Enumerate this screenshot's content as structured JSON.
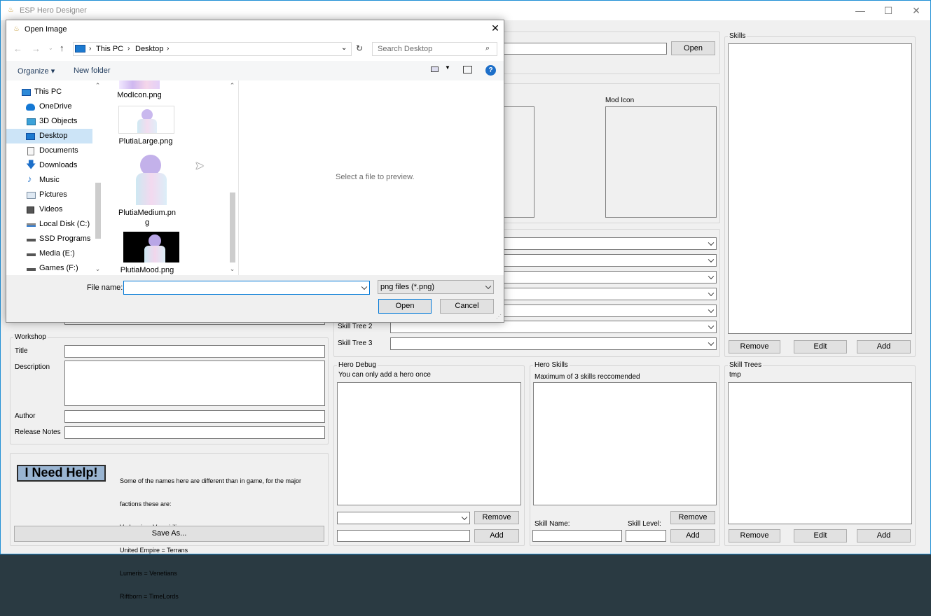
{
  "app": {
    "title": "ESP Hero Designer",
    "minimize": "—",
    "maximize": "☐",
    "close": "✕"
  },
  "top_group": {
    "open_button": "Open"
  },
  "mod_icon": {
    "label": "Mod Icon"
  },
  "skills": {
    "label": "Skills",
    "remove": "Remove",
    "edit": "Edit",
    "add": "Add"
  },
  "skill_trees_panel": {
    "label": "Skill Trees",
    "item": "tmp",
    "remove": "Remove",
    "edit": "Edit",
    "add": "Add"
  },
  "skill_tree_fields": {
    "tree2": "Skill Tree 2",
    "tree3": "Skill Tree 3"
  },
  "workshop": {
    "label": "Workshop",
    "title": "Title",
    "description": "Description",
    "author": "Author",
    "release_notes": "Release Notes"
  },
  "help": {
    "button": "I Need Help!",
    "notes": [
      "Some of the names here are different than in game, for the major",
      "factions these are:",
      "Vodyani   = Vampirilis",
      "United Empire = Terrans",
      "Lumeris = Venetians",
      "Riftborn = TimeLords"
    ],
    "save_as": "Save As..."
  },
  "hero_debug": {
    "label": "Hero Debug",
    "note": "You can only add a hero once",
    "remove": "Remove",
    "add": "Add"
  },
  "hero_skills": {
    "label": "Hero Skills",
    "note": "Maximum of 3 skills reccomended",
    "skill_name": "Skill Name:",
    "skill_level": "Skill Level:",
    "remove": "Remove",
    "add": "Add"
  },
  "dialog": {
    "title": "Open Image",
    "close": "✕",
    "breadcrumb": [
      "This PC",
      "Desktop"
    ],
    "search_placeholder": "Search Desktop",
    "organize": "Organize ▾",
    "new_folder": "New folder",
    "nav": [
      {
        "label": "This PC",
        "icon": "computer-icon"
      },
      {
        "label": "OneDrive",
        "icon": "cloud-icon"
      },
      {
        "label": "3D Objects",
        "icon": "cube-icon"
      },
      {
        "label": "Desktop",
        "icon": "desktop-icon",
        "selected": true
      },
      {
        "label": "Documents",
        "icon": "document-icon"
      },
      {
        "label": "Downloads",
        "icon": "download-icon"
      },
      {
        "label": "Music",
        "icon": "music-icon"
      },
      {
        "label": "Pictures",
        "icon": "pictures-icon"
      },
      {
        "label": "Videos",
        "icon": "video-icon"
      },
      {
        "label": "Local Disk (C:)",
        "icon": "disk-icon"
      },
      {
        "label": "SSD Programs (D",
        "icon": "drive-icon"
      },
      {
        "label": "Media (E:)",
        "icon": "drive-icon"
      },
      {
        "label": "Games (F:)",
        "icon": "drive-icon"
      }
    ],
    "files": [
      {
        "name": "ModIcon.png"
      },
      {
        "name": "PlutiaLarge.png"
      },
      {
        "name": "PlutiaMedium.pn\ng"
      },
      {
        "name": "PlutiaMood.png"
      }
    ],
    "preview_text": "Select a file to preview.",
    "file_name_label": "File name:",
    "file_name_value": "",
    "filter": "png files (*.png)",
    "open": "Open",
    "cancel": "Cancel"
  }
}
